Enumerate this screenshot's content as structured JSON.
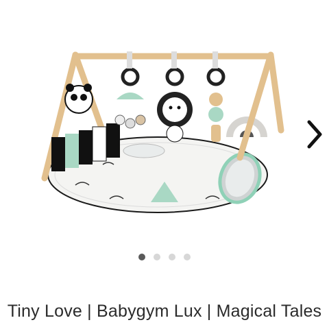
{
  "carousel": {
    "image_alt": "Tiny Love Babygym Lux Magical Tales play gym",
    "next_icon": "chevron-right-icon",
    "slides_total": 4,
    "active_index": 0
  },
  "product": {
    "title": "Tiny Love | Babygym Lux | Magical Tales"
  },
  "colors": {
    "text": "#2b2b2b",
    "dot_active": "#5a5a5a",
    "dot_inactive": "#d7d7d7",
    "mint": "#a9d8c4",
    "wood": "#e7c89a"
  }
}
